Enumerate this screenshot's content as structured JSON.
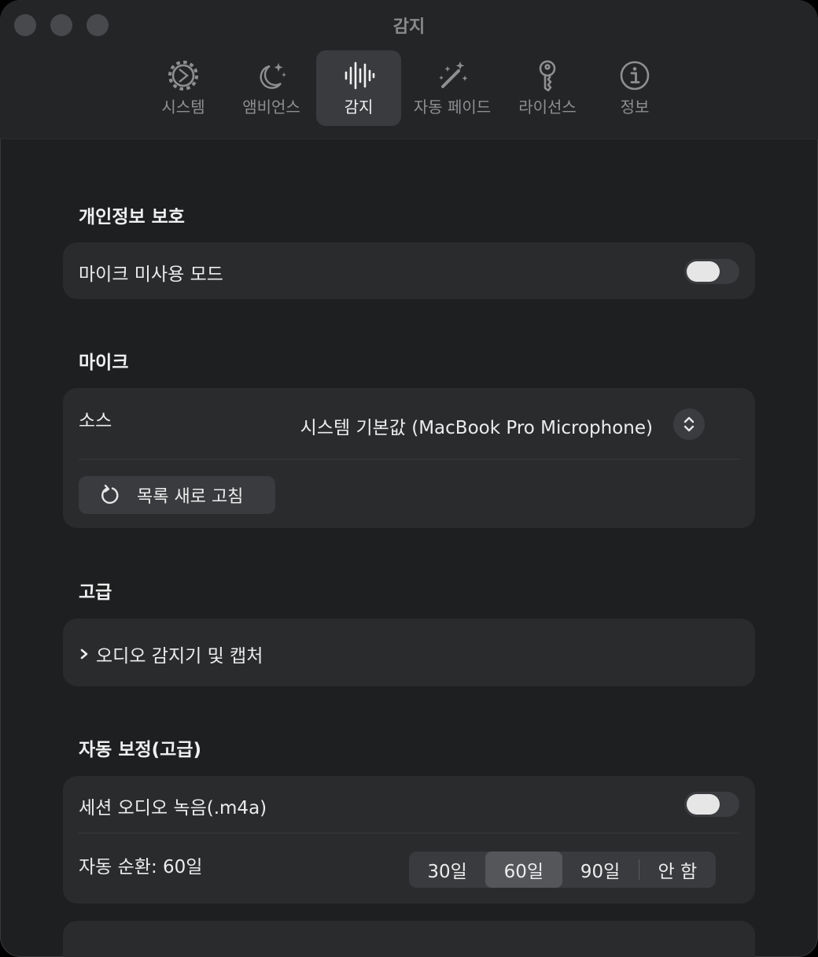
{
  "window": {
    "title": "감지"
  },
  "tabs": [
    {
      "label": "시스템",
      "icon": "gear-icon"
    },
    {
      "label": "앰비언스",
      "icon": "moon-stars-icon"
    },
    {
      "label": "감지",
      "icon": "waveform-icon",
      "active": true
    },
    {
      "label": "자동 페이드",
      "icon": "magic-wand-icon"
    },
    {
      "label": "라이선스",
      "icon": "key-icon"
    },
    {
      "label": "정보",
      "icon": "info-icon"
    }
  ],
  "privacy": {
    "title": "개인정보 보호",
    "mic_off_mode_label": "마이크 미사용 모드",
    "mic_off_mode_on": false
  },
  "mic": {
    "title": "마이크",
    "source_label": "소스",
    "source_value": "시스템 기본값 (MacBook Pro Microphone)",
    "refresh_label": "목록 새로 고침"
  },
  "advanced": {
    "title": "고급",
    "disclosure_label": "오디오 감지기 및 캡처"
  },
  "auto_correct": {
    "title": "자동 보정(고급)",
    "record_label": "세션 오디오 녹음(.m4a)",
    "record_on": false,
    "rotation_label": "자동 순환: 60일",
    "options": [
      "30일",
      "60일",
      "90일",
      "안 함"
    ],
    "selected": "60일"
  },
  "colors": {
    "window_bg": "#1e1f21",
    "card_bg": "#2a2b2d",
    "selected_segment": "#55565a"
  }
}
